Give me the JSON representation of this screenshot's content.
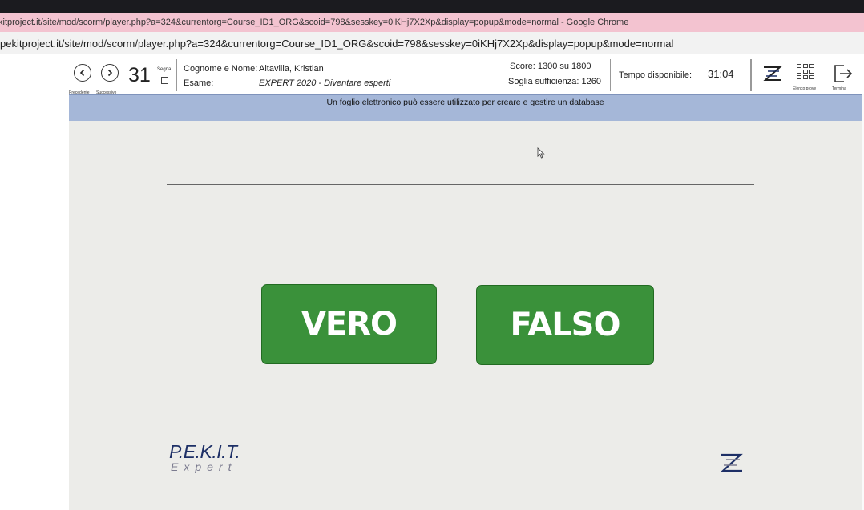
{
  "browser": {
    "window_title": "kitproject.it/site/mod/scorm/player.php?a=324&currentorg=Course_ID1_ORG&scoid=798&sesskey=0iKHj7X2Xp&display=popup&mode=normal - Google Chrome",
    "address": "pekitproject.it/site/mod/scorm/player.php?a=324&currentorg=Course_ID1_ORG&scoid=798&sesskey=0iKHj7X2Xp&display=popup&mode=normal"
  },
  "toolbar": {
    "prev_label": "Precedente",
    "next_label": "Successivo",
    "question_number": "31",
    "segna_label": "Segna",
    "name_label": "Cognome e Nome:",
    "name_value": "Altavilla, Kristian",
    "exam_label": "Esame:",
    "exam_value": "EXPERT 2020 - Diventare esperti",
    "score_text": "Score: 1300 su 1800",
    "threshold_text": "Soglia sufficienza: 1260",
    "time_label": "Tempo disponibile:",
    "time_value": "31:04",
    "elenco_label": "Elenco prove",
    "termina_label": "Termina"
  },
  "question": {
    "text": "Un foglio elettronico può essere utilizzato per creare e gestire un database"
  },
  "answers": {
    "true_label": "VERO",
    "false_label": "FALSO"
  },
  "logo": {
    "main": "P.E.K.I.T.",
    "sub": "Expert"
  },
  "colors": {
    "answer_green": "#3a913a",
    "question_bar": "#a5b7d8",
    "title_bar": "#f3c3d0"
  },
  "icons": [
    "chevron-left-icon",
    "chevron-right-icon",
    "checkbox-icon",
    "pekit-logo-icon",
    "grid-icon",
    "exit-icon"
  ]
}
